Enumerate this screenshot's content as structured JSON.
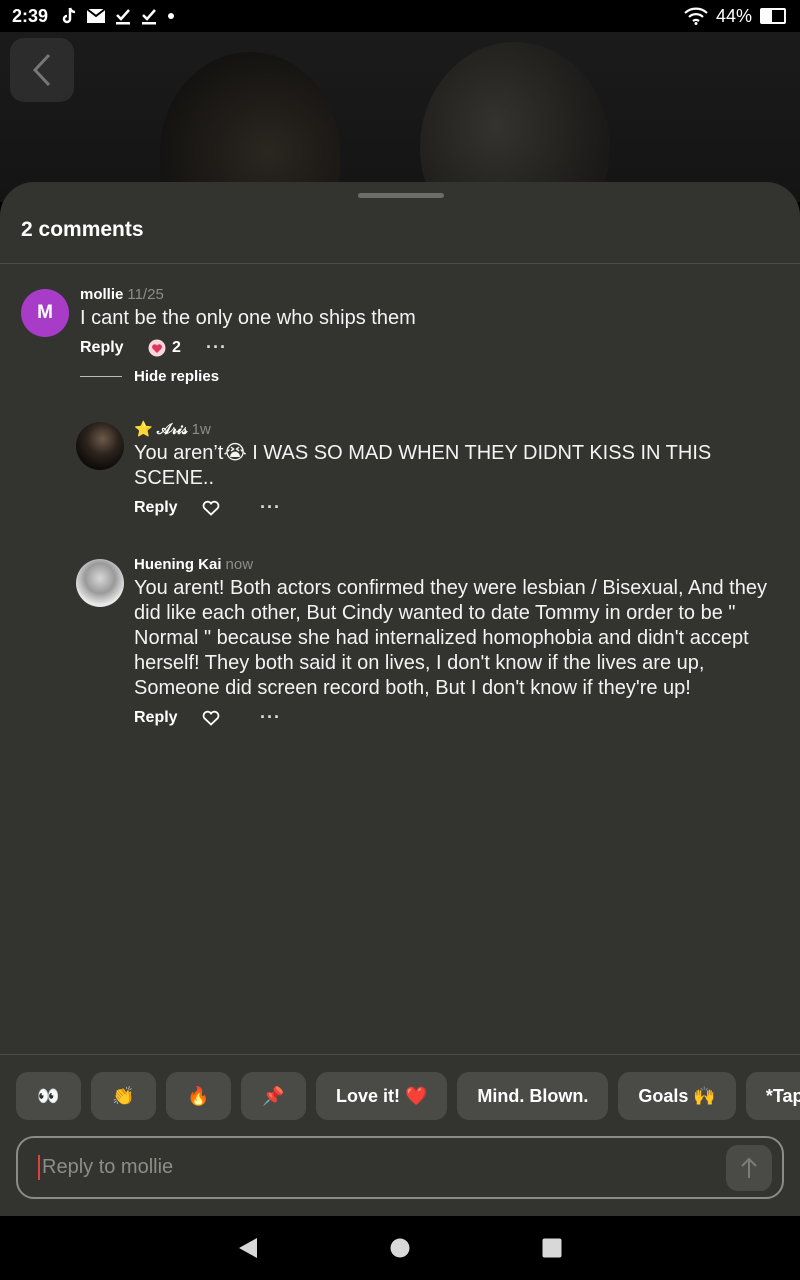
{
  "status": {
    "time": "2:39",
    "battery": "44%"
  },
  "sheet": {
    "title": "2 comments"
  },
  "comments": [
    {
      "avatar_letter": "M",
      "user": "mollie",
      "time": "11/25",
      "text": "I cant be the only one who ships them",
      "reply": "Reply",
      "likes": "2"
    }
  ],
  "hide_replies": "Hide replies",
  "replies": [
    {
      "user": "⭐ 𝒜𝓇𝒾𝓈",
      "time": "1w",
      "text": "You aren’t😭 I WAS SO MAD WHEN THEY DIDNT KISS IN THIS SCENE..",
      "reply": "Reply"
    },
    {
      "user": "Huening Kai",
      "time": "now",
      "text": "You arent! Both actors confirmed they were lesbian / Bisexual, And they did like each other, But Cindy wanted to date Tommy in order to be \" Normal \" because she had internalized homophobia and didn't accept herself! They both said it on lives, I don't know if the lives are up, Someone did screen record both, But I don't know if they're up!",
      "reply": "Reply"
    }
  ],
  "quick_reactions": [
    "👀",
    "👏",
    "🔥",
    "📌",
    "Love it! ❤️",
    "Mind. Blown.",
    "Goals 🙌",
    "*Tap"
  ],
  "input": {
    "placeholder": "Reply to mollie"
  }
}
